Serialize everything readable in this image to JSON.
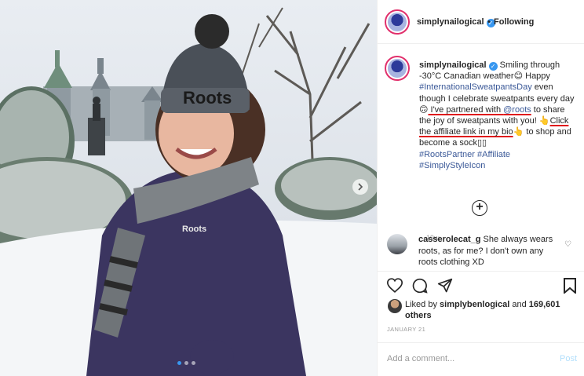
{
  "header": {
    "username": "simplynailogical",
    "separator": "•",
    "follow_label": "Following"
  },
  "caption": {
    "username": "simplynailogical",
    "p1": " Smiling through -30°C Canadian weather",
    "emoji1": "😊",
    "p2": " Happy ",
    "hashtag1": "#InternationalSweatpantsDay",
    "p3": " even though I celebrate sweatpants every day",
    "emoji2": "🙃",
    "p4": " I've partnered with ",
    "mention": "@roots",
    "p5": " to share the joy of sweatpants with you!",
    "emoji3": "👆",
    "p6": "Click the affiliate link in my bio",
    "emoji4": "👆",
    "p7": " to shop and become a sock▯▯",
    "hashtag2": "#RootsPartner",
    "hashtag3": "#Affiliate",
    "hashtag4": "#SimplyStyleIcon",
    "time": "19w"
  },
  "comment": {
    "username": "casserolecat_g",
    "text": " She always wears roots, as for me? I don't own any roots clothing XD"
  },
  "likes": {
    "prefix": "Liked by ",
    "user": "simplybenlogical",
    "middle": " and ",
    "count": "169,601 others"
  },
  "date": "JANUARY 21",
  "add_comment": {
    "placeholder": "Add a comment...",
    "post_label": "Post"
  },
  "photo": {
    "hat_text": "Roots",
    "shirt_text": "Roots",
    "carousel_count": 3,
    "active_index": 0
  },
  "colors": {
    "verified": "#3897f0",
    "link": "#3b5998",
    "underline": "#e0191c"
  }
}
